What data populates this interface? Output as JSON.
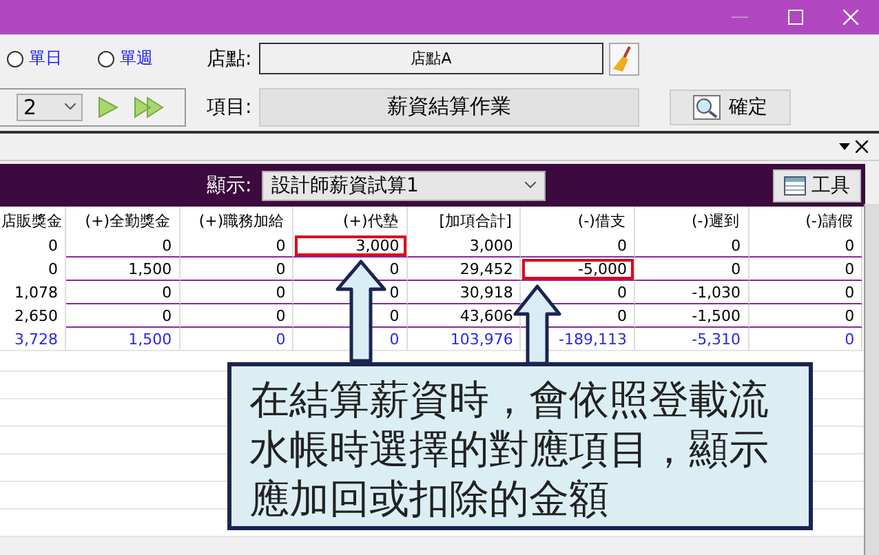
{
  "window": {
    "minimize_disabled": true
  },
  "filters": {
    "radios": [
      {
        "label": "單日",
        "selected": false
      },
      {
        "label": "單週",
        "selected": false
      }
    ],
    "week": {
      "value": "2"
    },
    "store": {
      "label": "店點:",
      "value": "店點A"
    },
    "item": {
      "label": "項目:",
      "value": "薪資結算作業"
    },
    "confirm_button": "確定"
  },
  "panel": {
    "display_label": "顯示:",
    "display_value": "設計師薪資試算1",
    "tools_button": "工具"
  },
  "table": {
    "columns": [
      "店販獎金",
      "(+)全勤獎金",
      "(+)職務加給",
      "(+)代墊",
      "[加項合計]",
      "(-)借支",
      "(-)遲到",
      "(-)請假"
    ],
    "rows": [
      {
        "kind": "data",
        "cells": [
          {
            "text": "0",
            "highlighted": false
          },
          {
            "text": "0",
            "highlighted": false
          },
          {
            "text": "0",
            "highlighted": false
          },
          {
            "text": "3,000",
            "highlighted": true
          },
          {
            "text": "3,000",
            "highlighted": false
          },
          {
            "text": "0",
            "highlighted": false
          },
          {
            "text": "0",
            "highlighted": false
          },
          {
            "text": "0",
            "highlighted": false
          }
        ]
      },
      {
        "kind": "data",
        "cells": [
          {
            "text": "0",
            "highlighted": false
          },
          {
            "text": "1,500",
            "highlighted": false
          },
          {
            "text": "0",
            "highlighted": false
          },
          {
            "text": "0",
            "highlighted": false
          },
          {
            "text": "29,452",
            "highlighted": false
          },
          {
            "text": "-5,000",
            "highlighted": true
          },
          {
            "text": "0",
            "highlighted": false
          },
          {
            "text": "0",
            "highlighted": false
          }
        ]
      },
      {
        "kind": "data",
        "cells": [
          {
            "text": "1,078",
            "highlighted": false
          },
          {
            "text": "0",
            "highlighted": false
          },
          {
            "text": "0",
            "highlighted": false
          },
          {
            "text": "0",
            "highlighted": false
          },
          {
            "text": "30,918",
            "highlighted": false
          },
          {
            "text": "0",
            "highlighted": false
          },
          {
            "text": "-1,030",
            "highlighted": false
          },
          {
            "text": "0",
            "highlighted": false
          }
        ]
      },
      {
        "kind": "data",
        "cells": [
          {
            "text": "2,650",
            "highlighted": false
          },
          {
            "text": "0",
            "highlighted": false
          },
          {
            "text": "0",
            "highlighted": false
          },
          {
            "text": "0",
            "highlighted": false
          },
          {
            "text": "43,606",
            "highlighted": false
          },
          {
            "text": "0",
            "highlighted": false
          },
          {
            "text": "-1,500",
            "highlighted": false
          },
          {
            "text": "0",
            "highlighted": false
          }
        ]
      },
      {
        "kind": "total",
        "cells": [
          {
            "text": "3,728",
            "highlighted": false
          },
          {
            "text": "1,500",
            "highlighted": false
          },
          {
            "text": "0",
            "highlighted": false
          },
          {
            "text": "0",
            "highlighted": false
          },
          {
            "text": "103,976",
            "highlighted": false
          },
          {
            "text": "-189,113",
            "highlighted": false
          },
          {
            "text": "-5,310",
            "highlighted": false
          },
          {
            "text": "0",
            "highlighted": false
          }
        ]
      }
    ]
  },
  "callout": {
    "text": "在結算薪資時，會依照登載流水帳時選擇的對應項目，顯示應加回或扣除的金額"
  }
}
